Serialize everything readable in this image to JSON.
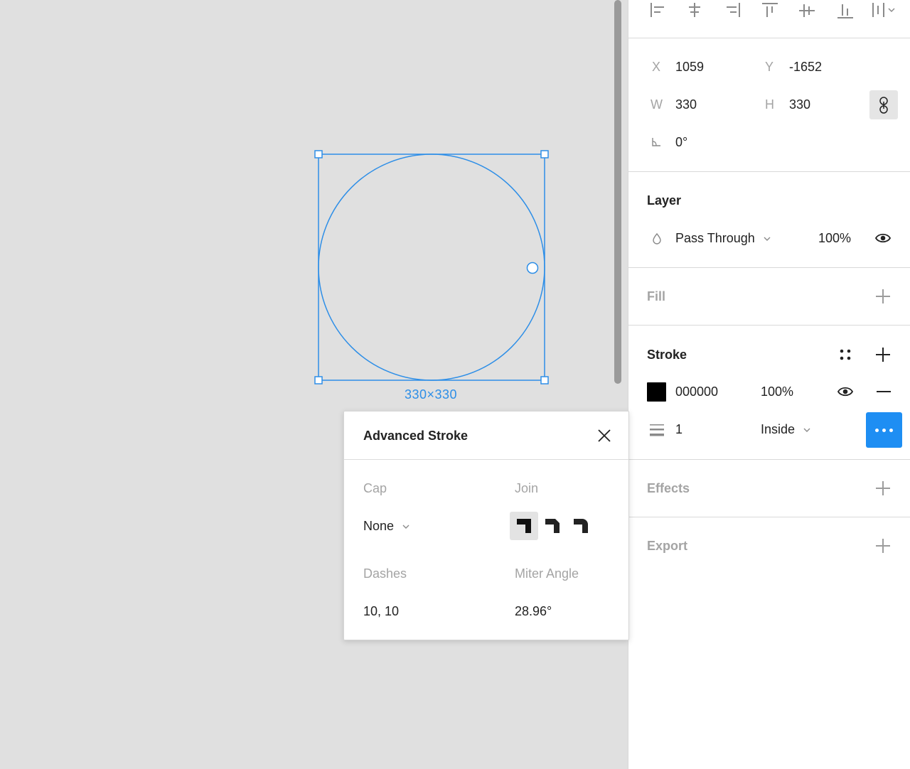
{
  "canvas": {
    "selection_size_label": "330×330",
    "accent_color": "#2d8ee7"
  },
  "align_icons": [
    "align-left-icon",
    "align-horizontal-center-icon",
    "align-right-icon",
    "align-top-icon",
    "align-vertical-center-icon",
    "align-bottom-icon",
    "distribute-icon"
  ],
  "transform": {
    "x_label": "X",
    "x_value": "1059",
    "y_label": "Y",
    "y_value": "-1652",
    "w_label": "W",
    "w_value": "330",
    "h_label": "H",
    "h_value": "330",
    "rotation_value": "0°"
  },
  "layer": {
    "title": "Layer",
    "blend_mode": "Pass Through",
    "opacity": "100%"
  },
  "fill": {
    "title": "Fill"
  },
  "stroke": {
    "title": "Stroke",
    "color_hex": "000000",
    "color_opacity": "100%",
    "weight": "1",
    "position": "Inside"
  },
  "effects": {
    "title": "Effects"
  },
  "export": {
    "title": "Export"
  },
  "advanced_stroke": {
    "title": "Advanced Stroke",
    "cap_label": "Cap",
    "cap_value": "None",
    "join_label": "Join",
    "join_options": [
      "join-miter-icon",
      "join-bevel-icon",
      "join-round-icon"
    ],
    "dashes_label": "Dashes",
    "dashes_value": "10, 10",
    "miter_label": "Miter Angle",
    "miter_value": "28.96°"
  }
}
